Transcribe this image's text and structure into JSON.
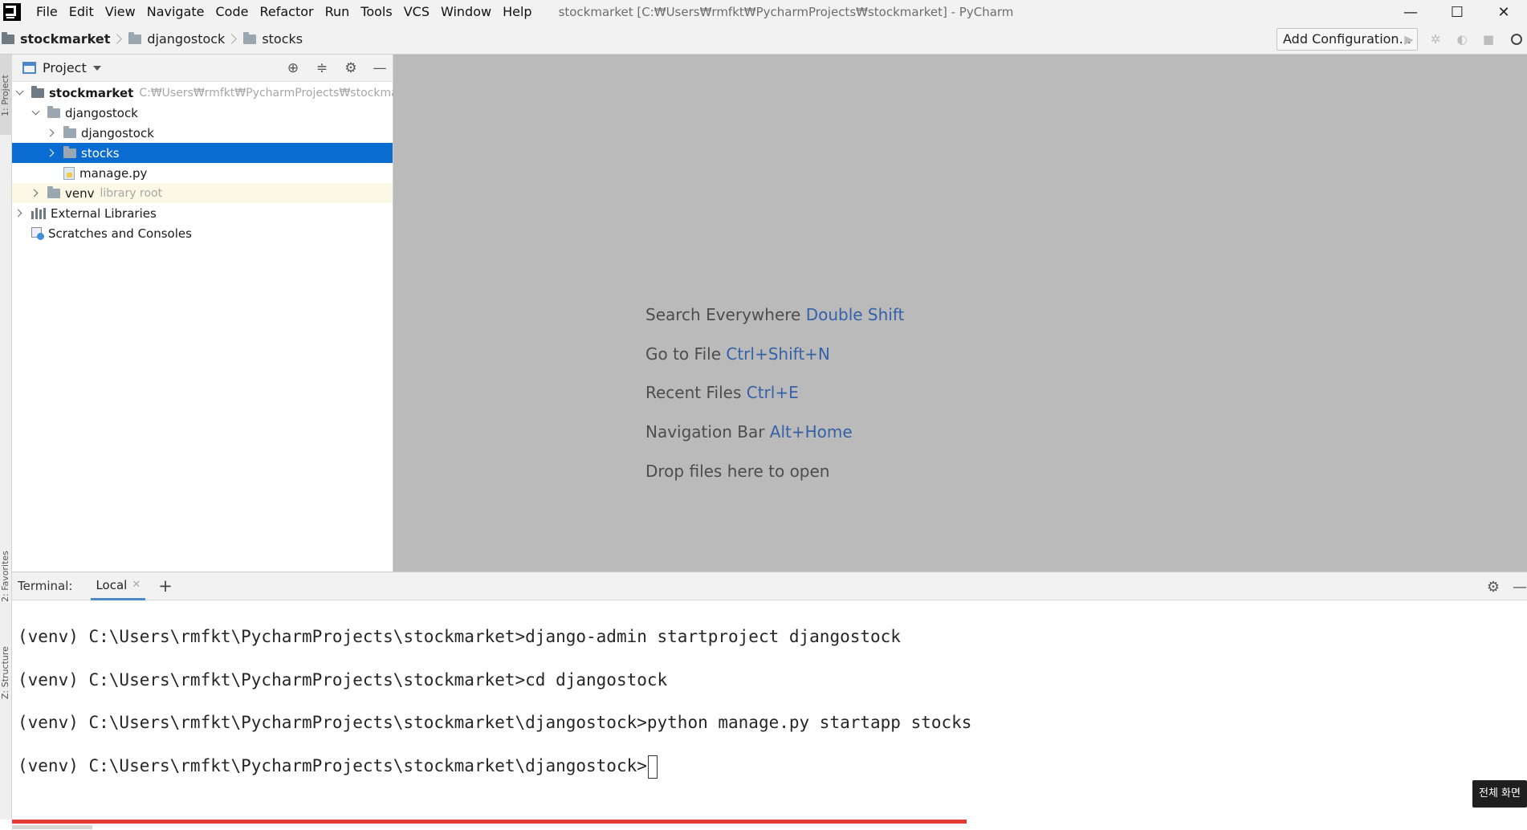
{
  "menu": [
    "File",
    "Edit",
    "View",
    "Navigate",
    "Code",
    "Refactor",
    "Run",
    "Tools",
    "VCS",
    "Window",
    "Help"
  ],
  "window_title": "stockmarket [C:₩Users₩rmfkt₩PycharmProjects₩stockmarket] - PyCharm",
  "window_controls": {
    "minimize": "—",
    "maximize": "☐",
    "close": "✕"
  },
  "breadcrumbs": [
    "stockmarket",
    "djangostock",
    "stocks"
  ],
  "toolbar": {
    "add_configuration": "Add Configuration..."
  },
  "side_strip": {
    "project": "1: Project",
    "favorites": "2: Favorites",
    "structure": "Z: Structure"
  },
  "project_panel": {
    "title": "Project",
    "tree": [
      {
        "label": "stockmarket",
        "hint": "C:₩Users₩rmfkt₩PycharmProjects₩stockmarket"
      },
      {
        "label": "djangostock"
      },
      {
        "label": "djangostock"
      },
      {
        "label": "stocks"
      },
      {
        "label": "manage.py"
      },
      {
        "label": "venv",
        "hint": "library root"
      },
      {
        "label": "External Libraries"
      },
      {
        "label": "Scratches and Consoles"
      }
    ]
  },
  "editor_hints": [
    {
      "text": "Search Everywhere",
      "shortcut": "Double Shift"
    },
    {
      "text": "Go to File",
      "shortcut": "Ctrl+Shift+N"
    },
    {
      "text": "Recent Files",
      "shortcut": "Ctrl+E"
    },
    {
      "text": "Navigation Bar",
      "shortcut": "Alt+Home"
    },
    {
      "text": "Drop files here to open",
      "shortcut": ""
    }
  ],
  "terminal": {
    "label": "Terminal:",
    "tab": "Local",
    "lines": [
      "(venv) C:\\Users\\rmfkt\\PycharmProjects\\stockmarket>django-admin startproject djangostock",
      "(venv) C:\\Users\\rmfkt\\PycharmProjects\\stockmarket>cd djangostock",
      "(venv) C:\\Users\\rmfkt\\PycharmProjects\\stockmarket\\djangostock>python manage.py startapp stocks",
      "(venv) C:\\Users\\rmfkt\\PycharmProjects\\stockmarket\\djangostock>"
    ]
  },
  "overlay": {
    "fullscreen_label": "전체 화면",
    "progress_fraction": 0.63
  },
  "colors": {
    "selection": "#0a6bd1",
    "shortcut": "#3461a8",
    "progress": "#e53935"
  }
}
